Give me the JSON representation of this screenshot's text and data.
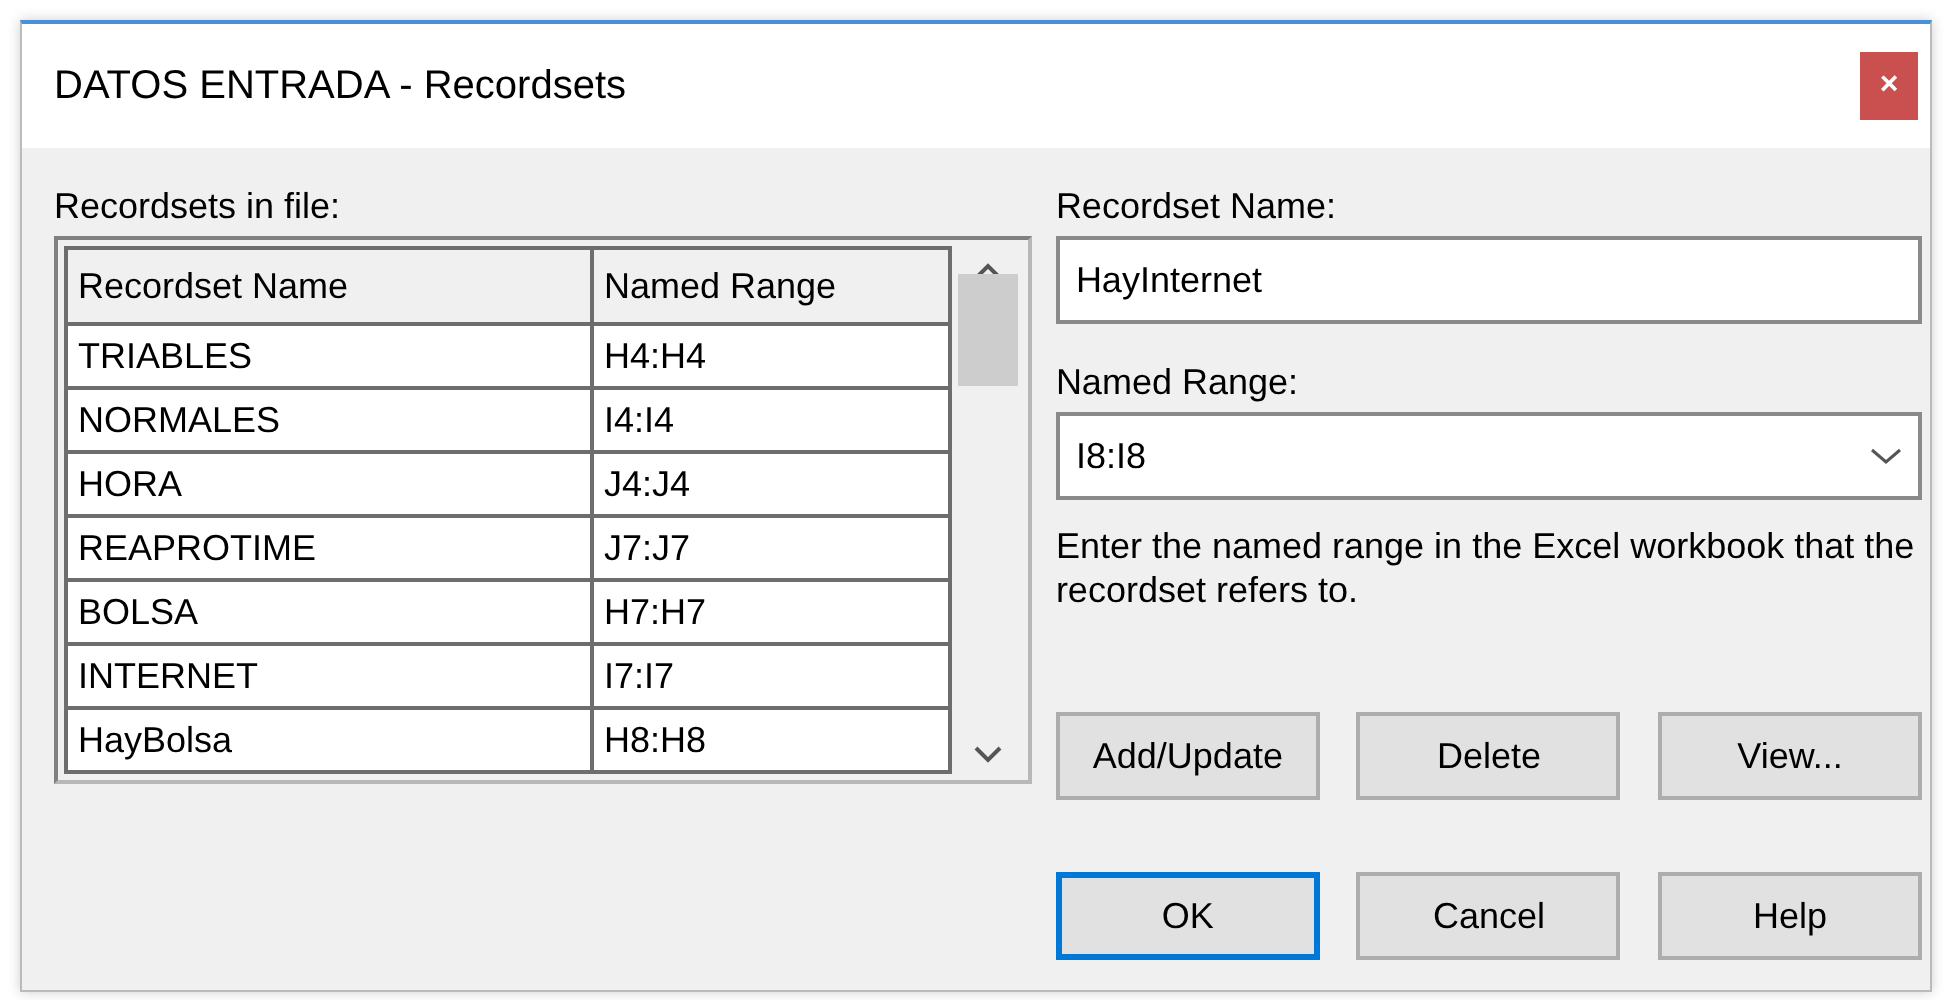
{
  "window": {
    "title": "DATOS ENTRADA - Recordsets",
    "close": "×"
  },
  "list_label": "Recordsets in file:",
  "table": {
    "columns": [
      "Recordset Name",
      "Named Range"
    ],
    "rows": [
      [
        "TRIABLES",
        "H4:H4"
      ],
      [
        "NORMALES",
        "I4:I4"
      ],
      [
        "HORA",
        "J4:J4"
      ],
      [
        "REAPROTIME",
        "J7:J7"
      ],
      [
        "BOLSA",
        "H7:H7"
      ],
      [
        "INTERNET",
        "I7:I7"
      ],
      [
        "HayBolsa",
        "H8:H8"
      ]
    ]
  },
  "name_field": {
    "label": "Recordset Name:",
    "value": "HayInternet"
  },
  "range_field": {
    "label": "Named Range:",
    "value": "I8:I8"
  },
  "hint": "Enter the named range in the Excel workbook that the recordset refers to.",
  "action_buttons": [
    {
      "label": "Add/Update",
      "default": false
    },
    {
      "label": "Delete",
      "default": false
    },
    {
      "label": "View...",
      "default": false
    }
  ],
  "dialog_buttons": [
    {
      "label": "OK",
      "default": true
    },
    {
      "label": "Cancel",
      "default": false
    },
    {
      "label": "Help",
      "default": false
    }
  ]
}
